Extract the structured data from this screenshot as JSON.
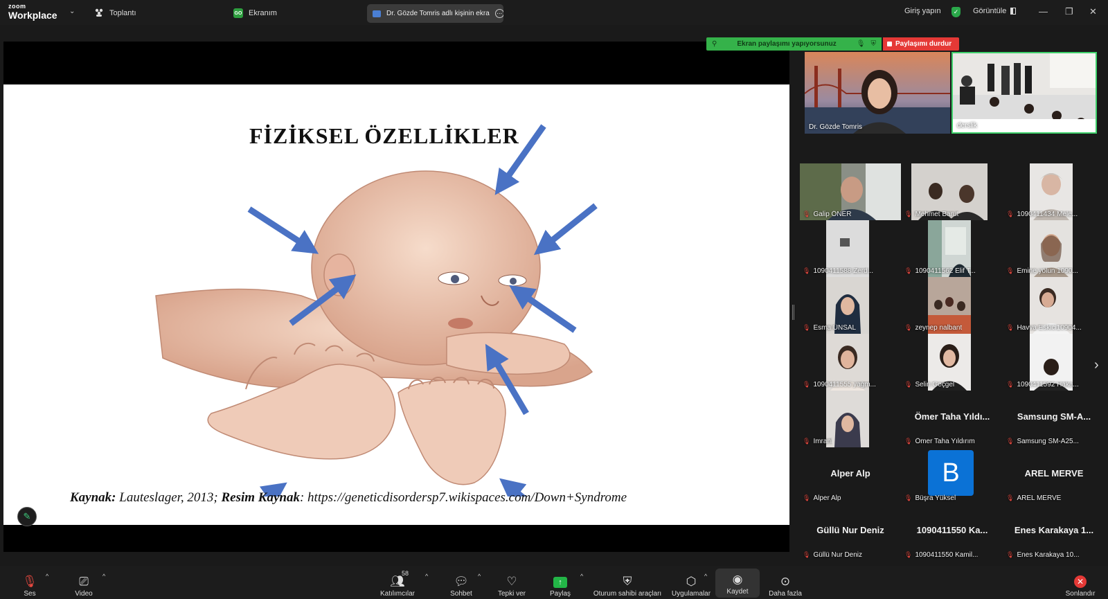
{
  "titlebar": {
    "logo_top": "zoom",
    "logo_bottom": "Workplace",
    "meeting_label": "Toplantı",
    "my_screen_label": "Ekranım",
    "my_screen_badge": "GO",
    "share_tab_label": "Dr. Gözde Tomris adlı kişinin ekra",
    "sign_in_label": "Giriş yapın",
    "view_label": "Görüntüle"
  },
  "slide": {
    "title": "FİZİKSEL ÖZELLİKLER",
    "source_label1": "Kaynak:",
    "source_text1": " Lauteslager, 2013; ",
    "source_label2": "Resim Kaynak",
    "source_text2": ": https://geneticdisordersp7.wikispaces.com/Down+Syndrome"
  },
  "sharing": {
    "status_text": "Ekran paylaşımı yapıyorsunuz",
    "stop_label": "Paylaşımı durdur"
  },
  "speakers": [
    {
      "name": "Dr. Gözde Tomris"
    },
    {
      "name": "derslik"
    }
  ],
  "gallery": [
    {
      "label": "Galip ÖNER"
    },
    {
      "label": "Mehmet Barut"
    },
    {
      "label": "1090411434 Mele..."
    },
    {
      "label": "1090411588 Zerd..."
    },
    {
      "label": "1090411562 Elif T..."
    },
    {
      "label": "Emine yolun 1090..."
    },
    {
      "label": "Esma ÜNSAL"
    },
    {
      "label": "zeynep nalbant"
    },
    {
      "label": "Havva Eskici10904..."
    },
    {
      "label": "1090411555 yağm..."
    },
    {
      "label": "Selin Geçgel"
    },
    {
      "label": "1090411592 Haka..."
    },
    {
      "label": "İmranl"
    },
    {
      "big": "Ömer Taha Yıldı...",
      "label": "Ömer Taha Yıldırım"
    },
    {
      "big": "Samsung SM-A...",
      "label": "Samsung SM-A25..."
    },
    {
      "big": "Alper Alp",
      "label": "Alper Alp"
    },
    {
      "avatar": "B",
      "label": "Büşra Yüksel"
    },
    {
      "big": "AREL MERVE",
      "label": "AREL MERVE"
    },
    {
      "big": "Güllü Nur Deniz",
      "label": "Güllü Nur Deniz"
    },
    {
      "big": "1090411550 Ka...",
      "label": "1090411550 Kamil..."
    },
    {
      "big": "Enes Karakaya 1...",
      "label": "Enes Karakaya 10..."
    }
  ],
  "toolbar": {
    "audio": "Ses",
    "video": "Video",
    "participants": "Katılımcılar",
    "participants_count": "58",
    "chat": "Sohbet",
    "react": "Tepki ver",
    "share": "Paylaş",
    "host_tools": "Oturum sahibi araçları",
    "apps": "Uygulamalar",
    "record": "Kaydet",
    "more": "Daha fazla",
    "end": "Sonlandır"
  },
  "colors": {
    "sharing_green": "#35b24a",
    "stop_red": "#e53936",
    "arrow_blue": "#4a72c4",
    "avatar_blue": "#0b72d6"
  }
}
